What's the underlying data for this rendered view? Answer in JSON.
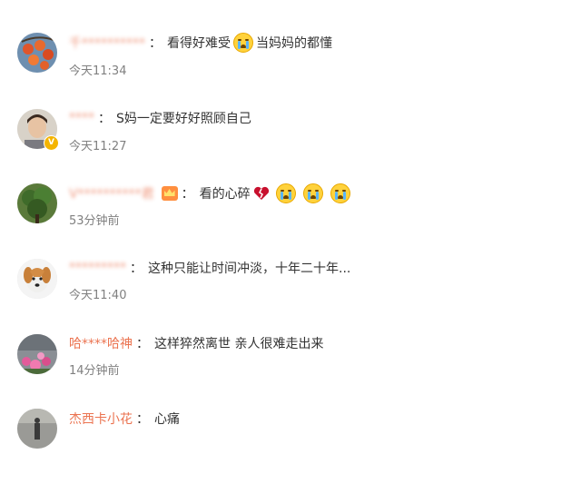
{
  "separator": "：",
  "comments": [
    {
      "user": "千**********",
      "segments": [
        "看得好难受",
        "当妈妈的都懂"
      ],
      "time": "今天11:34",
      "avatar": "persimmons-avatar",
      "verified": false
    },
    {
      "user": "****",
      "segments": [
        "S妈一定要好好照顾自己"
      ],
      "time": "今天11:27",
      "avatar": "man-avatar",
      "verified": true,
      "verified_label": "V"
    },
    {
      "user": "V**********君",
      "segments": [
        "看的心碎"
      ],
      "time": "53分钟前",
      "avatar": "tree-avatar",
      "badge": "crown-badge"
    },
    {
      "user": "*********",
      "segments": [
        "这种只能让时间冲淡，十年二十年..."
      ],
      "time": "今天11:40",
      "avatar": "dog-avatar"
    },
    {
      "user": "哈****哈神",
      "segments": [
        "这样猝然离世 亲人很难走出来"
      ],
      "time": "14分钟前",
      "avatar": "flowers-avatar"
    },
    {
      "user": "杰西卡小花",
      "segments": [
        "心痛"
      ],
      "time": "",
      "avatar": "street-avatar"
    }
  ],
  "icons": {
    "crying_emoji": "crying-face-icon",
    "broken_heart": "broken-heart-icon",
    "crown": "crown-icon"
  },
  "colors": {
    "username": "#eb7350",
    "text": "#333333",
    "time": "#808080"
  }
}
